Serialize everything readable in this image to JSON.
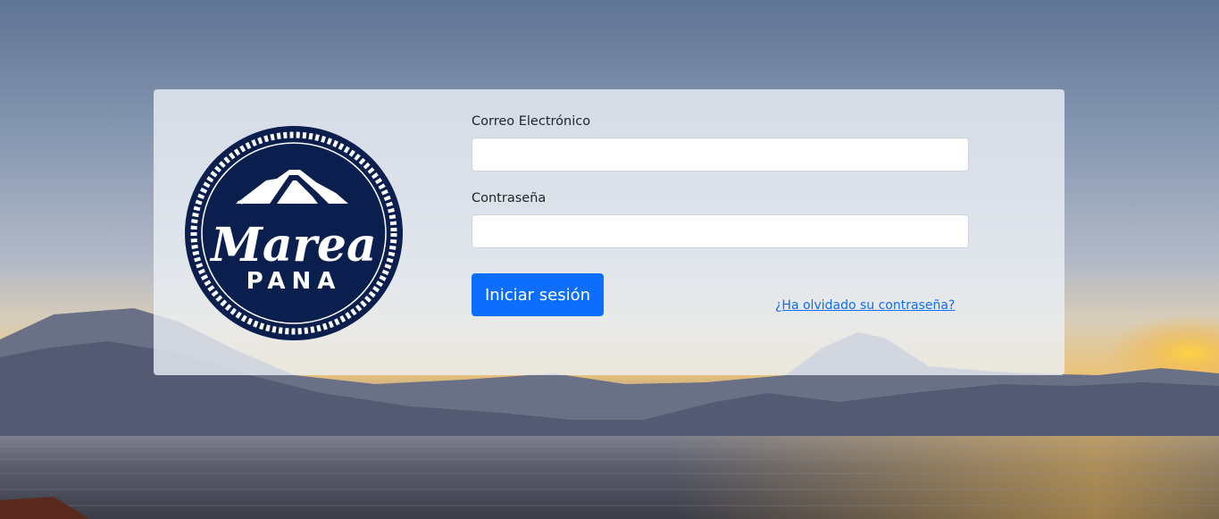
{
  "login_form": {
    "email_label": "Correo Electrónico",
    "email_value": "",
    "password_label": "Contraseña",
    "password_value": "",
    "submit_label": "Iniciar sesión",
    "forgot_password_label": "¿Ha olvidado su contraseña?"
  },
  "logo": {
    "text_script": "Marea",
    "text_caps": "PANA",
    "icon": "mountain-icon"
  },
  "colors": {
    "primary_button": "#0d6efd",
    "logo_navy": "#0b1f4e",
    "card_overlay": "rgba(236,240,245,0.80)"
  }
}
